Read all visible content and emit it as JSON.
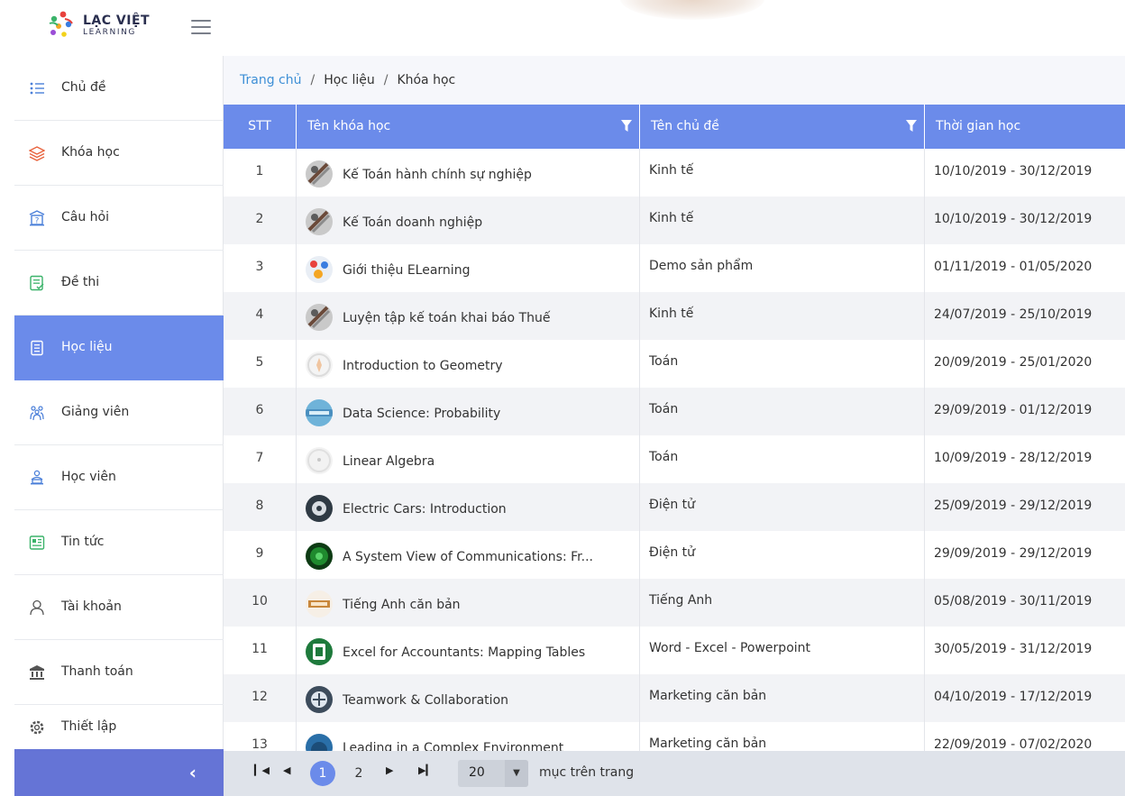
{
  "brand": {
    "title": "LẠC VIỆT",
    "subtitle": "LEARNING"
  },
  "sidebar": {
    "items": [
      {
        "label": "Chủ đề",
        "icon": "list-icon"
      },
      {
        "label": "Khóa học",
        "icon": "layers-icon"
      },
      {
        "label": "Câu hỏi",
        "icon": "question-icon"
      },
      {
        "label": "Đề thi",
        "icon": "exam-icon"
      },
      {
        "label": "Học liệu",
        "icon": "document-icon",
        "active": true
      },
      {
        "label": "Giảng viên",
        "icon": "teachers-icon"
      },
      {
        "label": "Học viên",
        "icon": "students-icon"
      },
      {
        "label": "Tin tức",
        "icon": "news-icon"
      },
      {
        "label": "Tài khoản",
        "icon": "user-icon"
      },
      {
        "label": "Thanh toán",
        "icon": "payment-icon"
      },
      {
        "label": "Thiết lập",
        "icon": "gear-icon"
      }
    ]
  },
  "breadcrumb": {
    "home": "Trang chủ",
    "level2": "Học liệu",
    "current": "Khóa học"
  },
  "table": {
    "columns": [
      "STT",
      "Tên khóa học",
      "Tên chủ đề",
      "Thời gian học"
    ],
    "rows": [
      {
        "stt": "1",
        "name": "Kế Toán hành chính sự nghiệp",
        "topic": "Kinh tế",
        "time": "10/10/2019 - 30/12/2019"
      },
      {
        "stt": "2",
        "name": "Kế Toán doanh nghiệp",
        "topic": "Kinh tế",
        "time": "10/10/2019 - 30/12/2019"
      },
      {
        "stt": "3",
        "name": "Giới thiệu ELearning",
        "topic": "Demo sản phẩm",
        "time": "01/11/2019 - 01/05/2020"
      },
      {
        "stt": "4",
        "name": "Luyện tập kế toán khai báo Thuế",
        "topic": "Kinh tế",
        "time": "24/07/2019 - 25/10/2019"
      },
      {
        "stt": "5",
        "name": "Introduction to Geometry",
        "topic": "Toán",
        "time": "20/09/2019 - 25/01/2020"
      },
      {
        "stt": "6",
        "name": "Data Science: Probability",
        "topic": "Toán",
        "time": "29/09/2019 - 01/12/2019"
      },
      {
        "stt": "7",
        "name": "Linear Algebra",
        "topic": "Toán",
        "time": "10/09/2019 - 28/12/2019"
      },
      {
        "stt": "8",
        "name": "Electric Cars: Introduction",
        "topic": "Điện tử",
        "time": "25/09/2019 - 29/12/2019"
      },
      {
        "stt": "9",
        "name": "A System View of Communications: Fr...",
        "topic": "Điện tử",
        "time": "29/09/2019 - 29/12/2019"
      },
      {
        "stt": "10",
        "name": "Tiếng Anh căn bản",
        "topic": "Tiếng Anh",
        "time": "05/08/2019 - 30/11/2019"
      },
      {
        "stt": "11",
        "name": "Excel for Accountants: Mapping Tables",
        "topic": "Word - Excel - Powerpoint",
        "time": "30/05/2019 - 31/12/2019"
      },
      {
        "stt": "12",
        "name": "Teamwork & Collaboration",
        "topic": "Marketing căn bản",
        "time": "04/10/2019 - 17/12/2019"
      },
      {
        "stt": "13",
        "name": "Leading in a Complex Environment",
        "topic": "Marketing căn bản",
        "time": "22/09/2019 - 07/02/2020"
      }
    ]
  },
  "pager": {
    "pages": [
      "1",
      "2"
    ],
    "current_page": "1",
    "page_size": "20",
    "page_size_label": "mục trên trang"
  },
  "colors": {
    "accent": "#6b8bea",
    "collapse_bar": "#6574d6",
    "link": "#3d8fd6",
    "icon": "#4a7fd9"
  }
}
